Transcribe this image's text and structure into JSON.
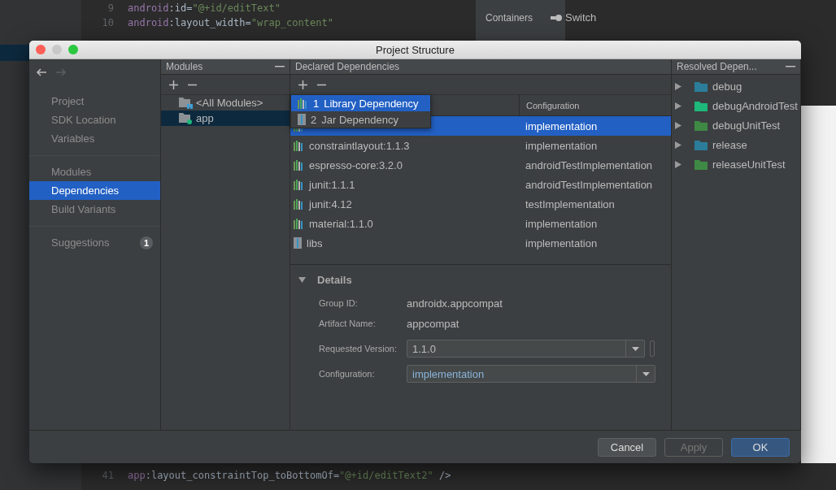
{
  "editor": {
    "top_lines": [
      {
        "number": "9",
        "tokens": [
          {
            "kind": "ns",
            "text": "android"
          },
          {
            "kind": "plain",
            "text": ":id="
          },
          {
            "kind": "string",
            "text": "\"@+id/editText\""
          }
        ]
      },
      {
        "number": "10",
        "tokens": [
          {
            "kind": "ns",
            "text": "android"
          },
          {
            "kind": "plain",
            "text": ":layout_width="
          },
          {
            "kind": "string",
            "text": "\"wrap_content\""
          }
        ]
      }
    ],
    "bottom_lines": [
      {
        "number": "41",
        "tokens": [
          {
            "kind": "ns",
            "text": "app"
          },
          {
            "kind": "plain",
            "text": ":layout_constraintTop_toBottomOf="
          },
          {
            "kind": "string",
            "text": "\"@+id/editText2\""
          },
          {
            "kind": "plain",
            "text": " />"
          }
        ]
      }
    ]
  },
  "palette": [
    {
      "category": "Containers",
      "item": "Switch"
    }
  ],
  "dialog": {
    "title": "Project Structure",
    "nav": {
      "back_disabled": false,
      "forward_disabled": true
    },
    "sidebar": [
      [
        {
          "label": "Project",
          "selected": false
        },
        {
          "label": "SDK Location",
          "selected": false
        },
        {
          "label": "Variables",
          "selected": false
        }
      ],
      [
        {
          "label": "Modules",
          "selected": false
        },
        {
          "label": "Dependencies",
          "selected": true
        },
        {
          "label": "Build Variants",
          "selected": false
        }
      ],
      [
        {
          "label": "Suggestions",
          "selected": false,
          "badge": "1"
        }
      ]
    ],
    "modules": {
      "title": "Modules",
      "items": [
        {
          "label": "<All Modules>",
          "kind": "all",
          "selected": false
        },
        {
          "label": "app",
          "kind": "module",
          "selected": true
        }
      ]
    },
    "declared": {
      "title": "Declared Dependencies",
      "config_column": "Configuration",
      "rows": [
        {
          "configuration": "implementation",
          "kind": "library",
          "selected": true
        },
        {
          "name": "constraintlayout:1.1.3",
          "configuration": "implementation",
          "kind": "library",
          "selected": false
        },
        {
          "name": "espresso-core:3.2.0",
          "configuration": "androidTestImplementation",
          "kind": "library",
          "selected": false
        },
        {
          "name": "junit:1.1.1",
          "configuration": "androidTestImplementation",
          "kind": "library",
          "selected": false
        },
        {
          "name": "junit:4.12",
          "configuration": "testImplementation",
          "kind": "library",
          "selected": false
        },
        {
          "name": "material:1.1.0",
          "configuration": "implementation",
          "kind": "library",
          "selected": false
        },
        {
          "name": "libs",
          "configuration": "implementation",
          "kind": "jar",
          "selected": false
        }
      ],
      "menu": [
        {
          "number": "1",
          "label": "Library Dependency",
          "kind": "library",
          "selected": true
        },
        {
          "number": "2",
          "label": "Jar Dependency",
          "kind": "jar",
          "selected": false
        }
      ]
    },
    "details": {
      "title": "Details",
      "expanded": true,
      "fields": [
        {
          "kind": "text",
          "label": "Group ID:",
          "value": "androidx.appcompat"
        },
        {
          "kind": "text",
          "label": "Artifact Name:",
          "value": "appcompat"
        },
        {
          "kind": "combo",
          "label": "Requested Version:",
          "value": "1.1.0"
        },
        {
          "kind": "select",
          "label": "Configuration:",
          "value": "implementation"
        }
      ]
    },
    "resolved": {
      "title": "Resolved Depen...",
      "items": [
        {
          "label": "debug",
          "color": "#2b7d9a"
        },
        {
          "label": "debugAndroidTest",
          "color": "#1db87a"
        },
        {
          "label": "debugUnitTest",
          "color": "#3e8a45"
        },
        {
          "label": "release",
          "color": "#2b7d9a"
        },
        {
          "label": "releaseUnitTest",
          "color": "#3e8a45"
        }
      ]
    },
    "buttons": [
      {
        "label": "Cancel",
        "kind": "default",
        "disabled": false
      },
      {
        "label": "Apply",
        "kind": "default",
        "disabled": true
      },
      {
        "label": "OK",
        "kind": "primary",
        "disabled": false
      }
    ]
  }
}
